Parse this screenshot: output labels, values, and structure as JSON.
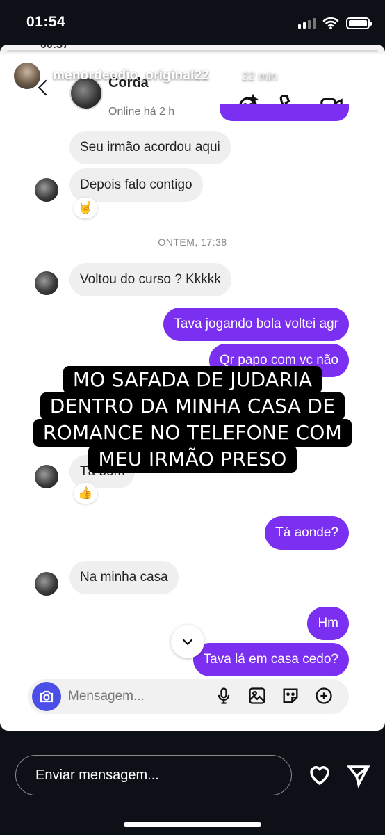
{
  "status_bar": {
    "time": "01:54"
  },
  "story": {
    "username": "menordeodio_original22",
    "posted_ago": "22 min",
    "embedded_time": "00:37",
    "chat": {
      "contact_name": "Corda",
      "contact_status": "Online há 2 h",
      "date_separator": "ONTEM, 17:38",
      "messages": [
        {
          "side": "in",
          "text": "Seu irmão acordou aqui"
        },
        {
          "side": "in",
          "text": "Depois falo contigo",
          "reaction": "🤘"
        },
        {
          "side": "in",
          "text": "Voltou do curso ? Kkkkk"
        },
        {
          "side": "out",
          "text": "Tava jogando bola voltei agr"
        },
        {
          "side": "out",
          "text": "Qr papo com vc não"
        },
        {
          "side": "in",
          "text": "Tá bom",
          "reaction": "👍"
        },
        {
          "side": "out",
          "text": "Tá aonde?"
        },
        {
          "side": "in",
          "text": "Na minha casa"
        },
        {
          "side": "out",
          "text": "Hm"
        },
        {
          "side": "out",
          "text": "Tava lá em casa cedo?"
        }
      ],
      "composer_placeholder": "Mensagem..."
    },
    "caption_lines": [
      "MO SAFADA DE JUDARIA",
      "DENTRO DA MINHA CASA DE",
      "ROMANCE NO TELEFONE COM",
      "MEU IRMÃO PRESO"
    ]
  },
  "reply_bar": {
    "placeholder": "Enviar mensagem..."
  },
  "colors": {
    "outgoing_bubble": "#7b2ff0",
    "camera_button": "#4c4ee8"
  }
}
